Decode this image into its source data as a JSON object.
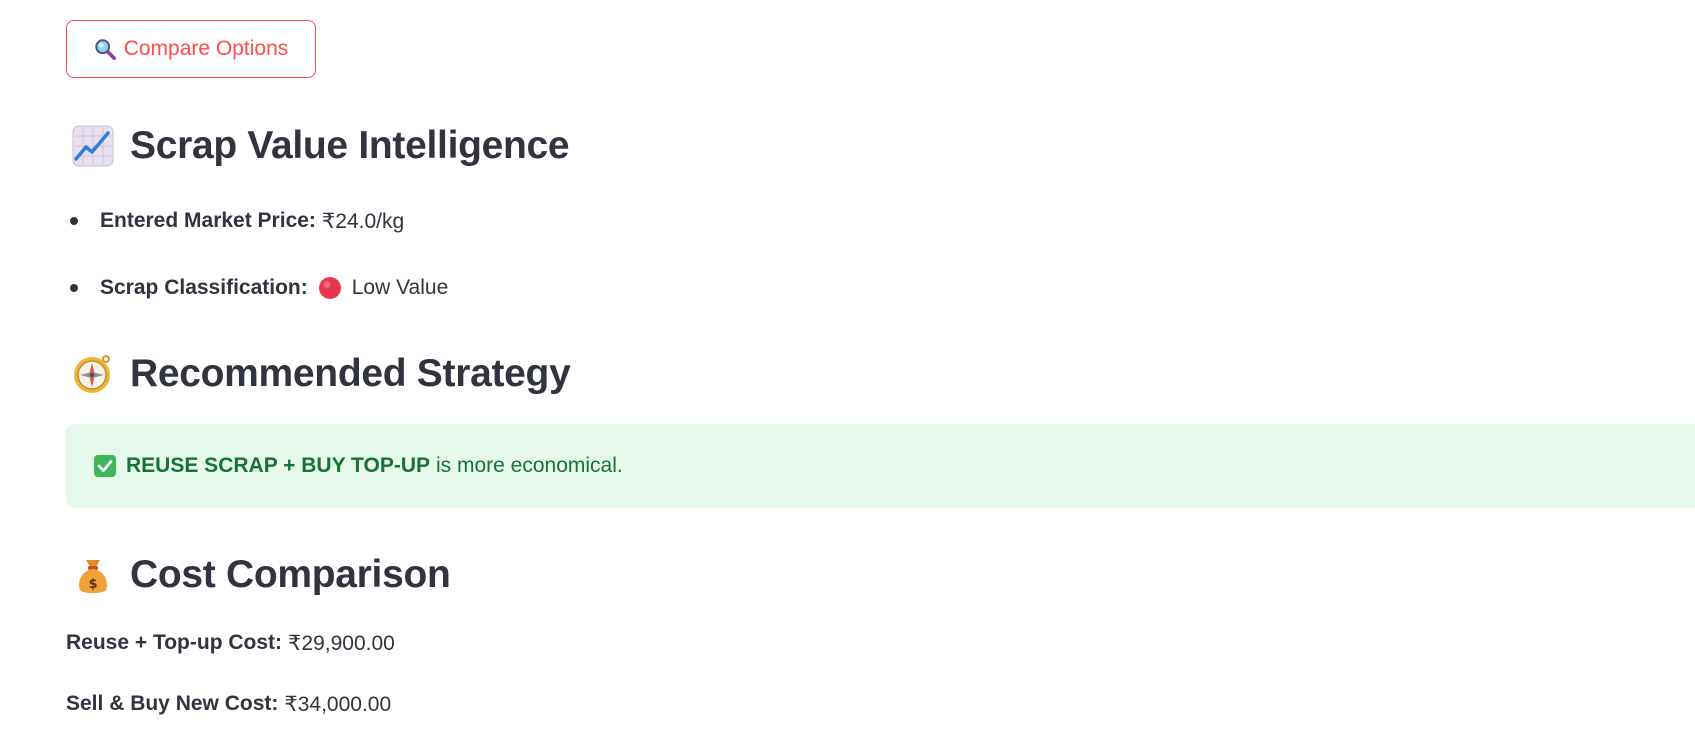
{
  "compare_button": {
    "icon": "magnifying-glass-icon",
    "label": "Compare Options"
  },
  "scrap_section": {
    "icon": "chart-increasing-icon",
    "title": "Scrap Value Intelligence",
    "items": [
      {
        "label": "Entered Market Price:",
        "value": "₹24.0/kg"
      },
      {
        "label": "Scrap Classification:",
        "icon": "red-circle-icon",
        "value": "Low Value"
      }
    ]
  },
  "strategy_section": {
    "icon": "compass-icon",
    "title": "Recommended Strategy",
    "message": {
      "icon": "check-mark-button-icon",
      "strong": "REUSE SCRAP + BUY TOP-UP",
      "rest": "is more economical."
    }
  },
  "cost_section": {
    "icon": "money-bag-icon",
    "title": "Cost Comparison",
    "rows": [
      {
        "label": "Reuse + Top-up Cost:",
        "value": "₹29,900.00"
      },
      {
        "label": "Sell & Buy New Cost:",
        "value": "₹34,000.00"
      }
    ]
  },
  "colors": {
    "primary": "#ff4b4b",
    "text": "#31333f",
    "success_bg": "#e6f8eb",
    "success_text": "#177233"
  }
}
